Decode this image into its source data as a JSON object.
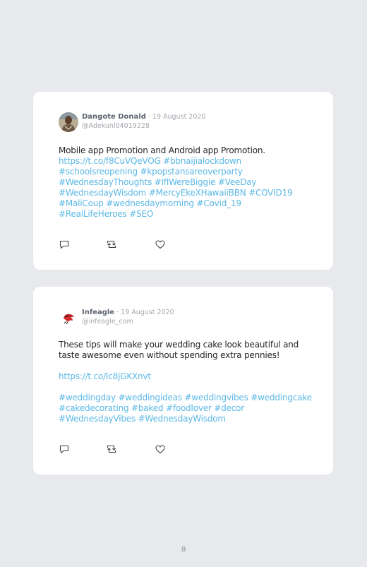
{
  "tweets": [
    {
      "author": "Dangote Donald",
      "date": " · 19 August 2020",
      "handle": "@Adekunl04019228",
      "lines": [
        "Mobile app Promotion and Android app Promotion.",
        "https://t.co/f8CuVQeVOG #bbnaijialockdown",
        "#schoolsreopening #kpopstansareoverparty",
        "#WednesdayThoughts #IfIWereBiggie #VeeDay",
        "#WednesdayWisdom #MercyEkeXHawaiiBBN #COVID19",
        "#MaliCoup #wednesdaymorning #Covid_19",
        "#RealLifeHeroes #SEO"
      ]
    },
    {
      "author": "Infeagle",
      "date": " · 19 August 2020",
      "handle": "@infeagle_com",
      "lines": [
        "These tips will make your wedding cake look beautiful and",
        "taste awesome even without spending extra pennies!",
        "https://t.co/Ic8jGKXnvt",
        "#weddingday #weddingideas #weddingvibes #weddingcake",
        "#cakedecorating #baked #foodlover #decor",
        "#WednesdayVibes #WednesdayWisdom"
      ]
    }
  ],
  "icons": [
    "reply-icon",
    "retweet-icon",
    "like-icon",
    "avatar-photo",
    "eagle-logo"
  ],
  "colors": {
    "background": "#e8e9ec",
    "card": "#ffffff",
    "link": "#5cb8e6",
    "text": "#22252a",
    "muted": "#a3a7ae"
  },
  "page_number": "8"
}
